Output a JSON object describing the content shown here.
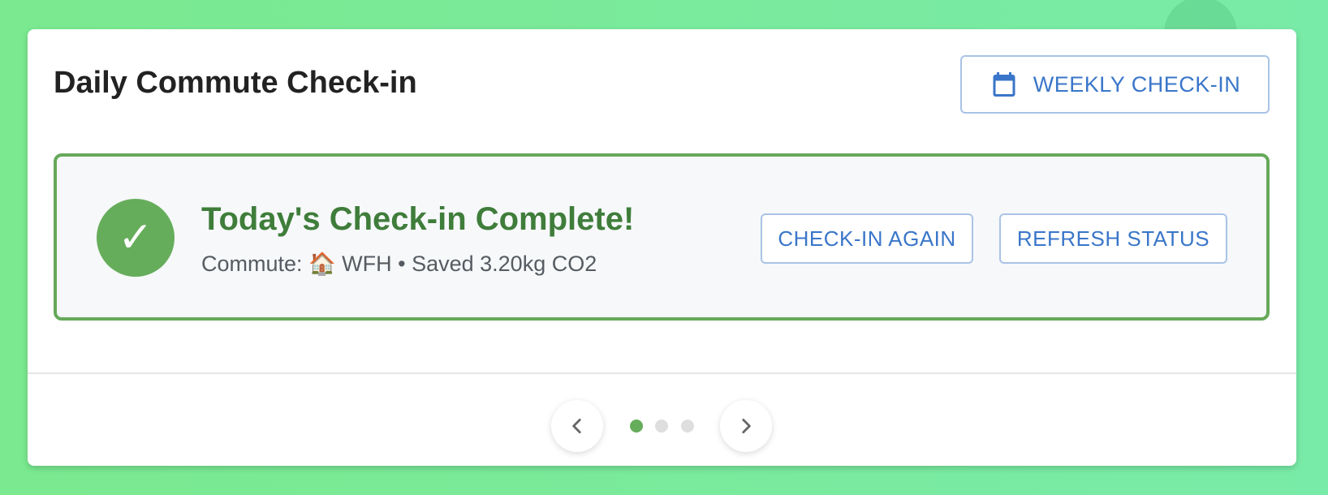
{
  "header": {
    "title": "Daily Commute Check-in",
    "weekly_button_label": "WEEKLY CHECK-IN"
  },
  "status": {
    "title": "Today's Check-in Complete!",
    "check_symbol": "✓",
    "subtitle": "Commute: 🏠 WFH • Saved 3.20kg CO2",
    "check_again_label": "CHECK-IN AGAIN",
    "refresh_label": "REFRESH STATUS"
  },
  "pagination": {
    "total_pages": 3,
    "current_page": 1
  },
  "colors": {
    "accent_green": "#66ad5b",
    "title_green": "#3f7d3a",
    "link_blue": "#3a76c9"
  }
}
